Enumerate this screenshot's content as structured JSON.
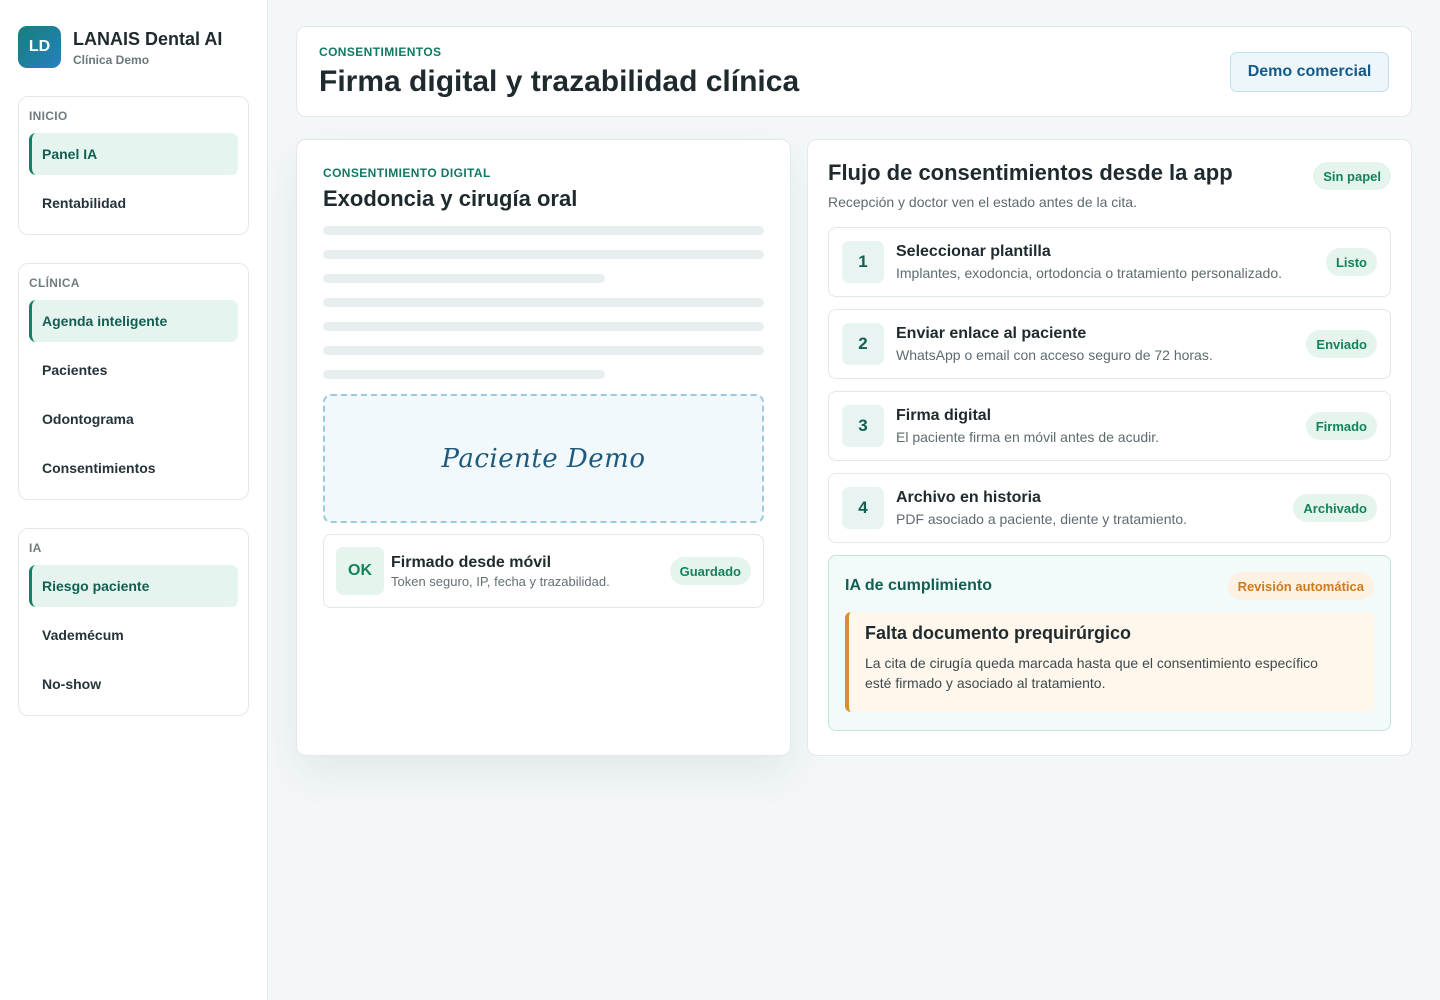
{
  "brand": {
    "initials": "LD",
    "name": "LANAIS Dental AI",
    "clinic": "Clínica Demo"
  },
  "sidebar": {
    "groups": [
      {
        "title": "INICIO",
        "items": [
          {
            "label": "Panel IA",
            "active": true
          },
          {
            "label": "Rentabilidad",
            "active": false
          }
        ]
      },
      {
        "title": "CLÍNICA",
        "items": [
          {
            "label": "Agenda inteligente",
            "active": true
          },
          {
            "label": "Pacientes",
            "active": false
          },
          {
            "label": "Odontograma",
            "active": false
          },
          {
            "label": "Consentimientos",
            "active": false
          }
        ]
      },
      {
        "title": "IA",
        "items": [
          {
            "label": "Riesgo paciente",
            "active": true
          },
          {
            "label": "Vademécum",
            "active": false
          },
          {
            "label": "No-show",
            "active": false
          }
        ]
      }
    ]
  },
  "header": {
    "eyebrow": "CONSENTIMIENTOS",
    "title": "Firma digital y trazabilidad clínica",
    "demo_button": "Demo comercial"
  },
  "document": {
    "eyebrow": "CONSENTIMIENTO DIGITAL",
    "title": "Exodoncia y cirugía oral",
    "signature": "Paciente Demo",
    "signed": {
      "badge": "OK",
      "title": "Firmado desde móvil",
      "subtitle": "Token seguro, IP, fecha y trazabilidad.",
      "status": "Guardado"
    }
  },
  "flow": {
    "title": "Flujo de consentimientos desde la app",
    "subtitle": "Recepción y doctor ven el estado antes de la cita.",
    "badge": "Sin papel",
    "steps": [
      {
        "num": "1",
        "title": "Seleccionar plantilla",
        "desc": "Implantes, exodoncia, ortodoncia o tratamiento personalizado.",
        "status": "Listo"
      },
      {
        "num": "2",
        "title": "Enviar enlace al paciente",
        "desc": "WhatsApp o email con acceso seguro de 72 horas.",
        "status": "Enviado"
      },
      {
        "num": "3",
        "title": "Firma digital",
        "desc": "El paciente firma en móvil antes de acudir.",
        "status": "Firmado"
      },
      {
        "num": "4",
        "title": "Archivo en historia",
        "desc": "PDF asociado a paciente, diente y tratamiento.",
        "status": "Archivado"
      }
    ]
  },
  "ai": {
    "title": "IA de cumplimiento",
    "badge": "Revisión automática",
    "alert_title": "Falta documento prequirúrgico",
    "alert_text": "La cita de cirugía queda marcada hasta que el consentimiento específico esté firmado y asociado al tratamiento."
  },
  "colors": {
    "accent": "#12806b",
    "warning": "#d8902f",
    "info": "#145a88"
  }
}
